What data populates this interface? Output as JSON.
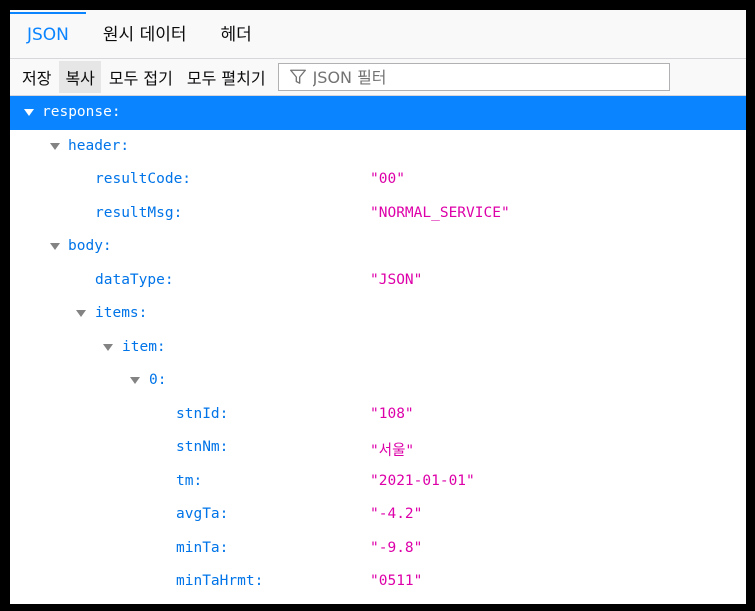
{
  "tabs": [
    {
      "label": "JSON",
      "active": true
    },
    {
      "label": "원시 데이터",
      "active": false
    },
    {
      "label": "헤더",
      "active": false
    }
  ],
  "toolbar": {
    "save_label": "저장",
    "copy_label": "복사",
    "collapse_all_label": "모두 접기",
    "expand_all_label": "모두 펼치기",
    "filter_placeholder": "JSON 필터",
    "filter_icon": "funnel-icon"
  },
  "tree": {
    "rows": [
      {
        "key": "response:",
        "value": "",
        "expandable": true,
        "selected": true
      },
      {
        "key": "header:",
        "value": "",
        "expandable": true
      },
      {
        "key": "resultCode:",
        "value": "\"00\""
      },
      {
        "key": "resultMsg:",
        "value": "\"NORMAL_SERVICE\""
      },
      {
        "key": "body:",
        "value": "",
        "expandable": true
      },
      {
        "key": "dataType:",
        "value": "\"JSON\""
      },
      {
        "key": "items:",
        "value": "",
        "expandable": true
      },
      {
        "key": "item:",
        "value": "",
        "expandable": true
      },
      {
        "key": "0:",
        "value": "",
        "expandable": true
      },
      {
        "key": "stnId:",
        "value": "\"108\""
      },
      {
        "key": "stnNm:",
        "value": "\"서울\""
      },
      {
        "key": "tm:",
        "value": "\"2021-01-01\""
      },
      {
        "key": "avgTa:",
        "value": "\"-4.2\""
      },
      {
        "key": "minTa:",
        "value": "\"-9.8\""
      },
      {
        "key": "minTaHrmt:",
        "value": "\"0511\""
      }
    ]
  },
  "colors": {
    "accent": "#0a84ff",
    "key": "#0074e8",
    "string_value": "#dd00a9"
  }
}
